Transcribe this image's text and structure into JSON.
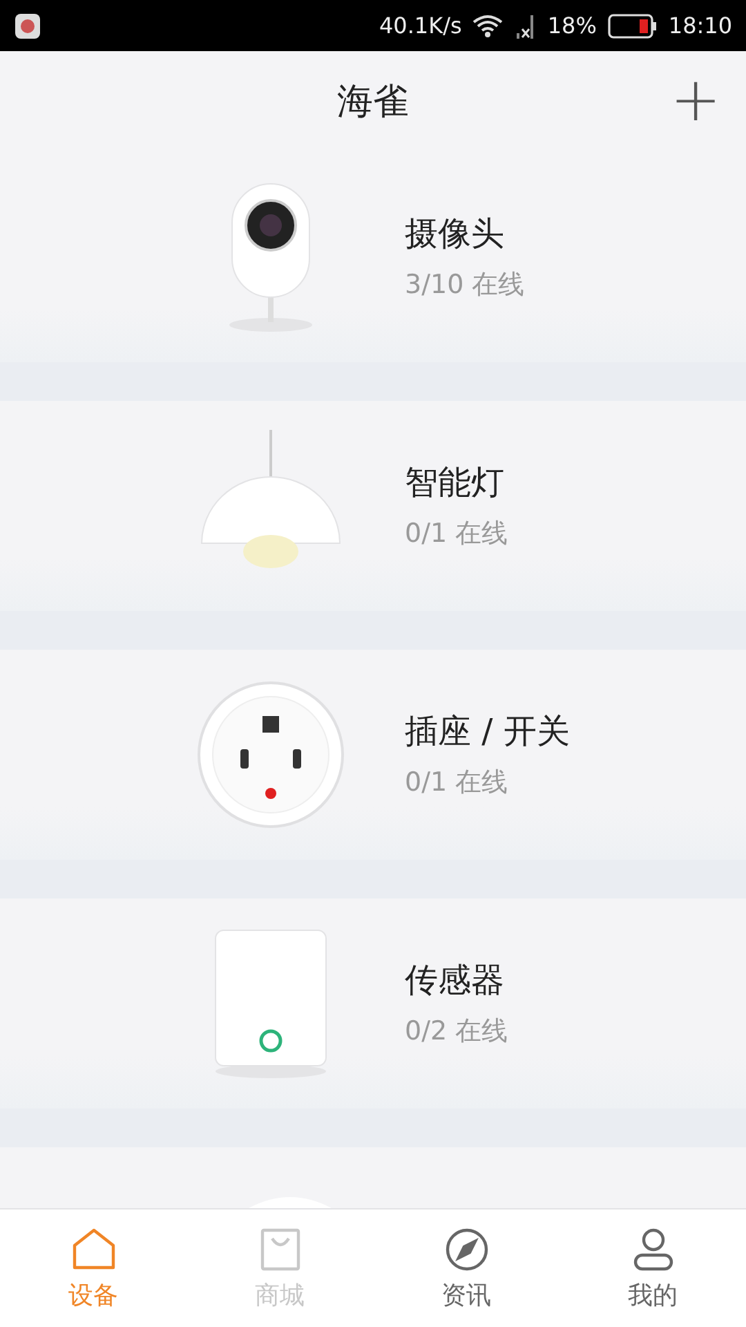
{
  "status_bar": {
    "speed": "40.1K/s",
    "battery": "18%",
    "time": "18:10"
  },
  "header": {
    "title": "海雀",
    "add_icon": "+"
  },
  "devices": [
    {
      "kind": "camera",
      "name": "摄像头",
      "status": "3/10 在线"
    },
    {
      "kind": "lamp",
      "name": "智能灯",
      "status": "0/1 在线"
    },
    {
      "kind": "plug",
      "name": "插座 / 开关",
      "status": "0/1 在线"
    },
    {
      "kind": "sensor",
      "name": "传感器",
      "status": "0/2 在线"
    }
  ],
  "tabs": [
    {
      "kind": "home",
      "label": "设备",
      "selected": true,
      "disabled": false
    },
    {
      "kind": "bag",
      "label": "商城",
      "selected": false,
      "disabled": true
    },
    {
      "kind": "compass",
      "label": "资讯",
      "selected": false,
      "disabled": false
    },
    {
      "kind": "user",
      "label": "我的",
      "selected": false,
      "disabled": false
    }
  ]
}
